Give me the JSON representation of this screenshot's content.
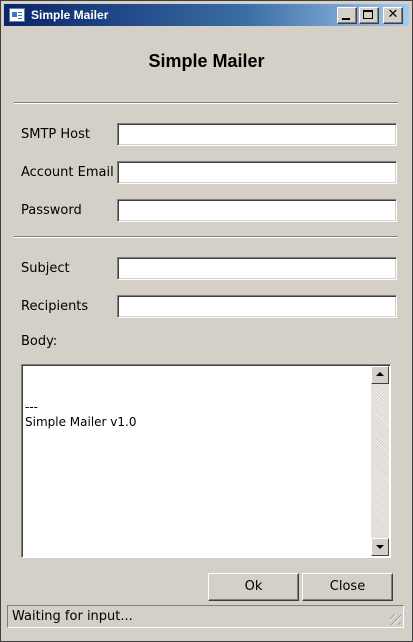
{
  "window": {
    "title": "Simple Mailer"
  },
  "header": {
    "heading": "Simple Mailer"
  },
  "account": {
    "smtp_host_label": "SMTP Host",
    "smtp_host_value": "",
    "email_label": "Account Email",
    "email_value": "",
    "password_label": "Password",
    "password_value": ""
  },
  "message": {
    "subject_label": "Subject",
    "subject_value": "",
    "recipients_label": "Recipients",
    "recipients_value": "",
    "body_label": "Body:",
    "body_value": "\n---\nSimple Mailer v1.0"
  },
  "buttons": {
    "ok_label": "Ok",
    "close_label": "Close"
  },
  "status": {
    "text": "Waiting for input..."
  },
  "icons": {
    "app": "mail-app-icon",
    "minimize": "minimize-icon",
    "maximize": "maximize-icon",
    "close": "close-icon",
    "scroll_up": "arrow-up-icon",
    "scroll_down": "arrow-down-icon"
  },
  "colors": {
    "window_bg": "#d4d0c8",
    "title_gradient_start": "#0a246a",
    "title_gradient_end": "#a6caf0"
  }
}
